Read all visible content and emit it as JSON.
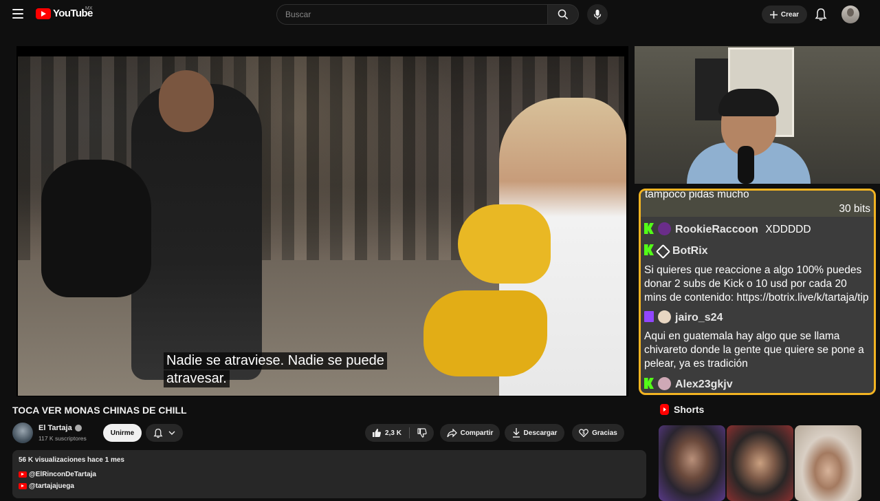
{
  "header": {
    "logo_text": "YouTube",
    "country": "MX",
    "search_placeholder": "Buscar",
    "create_label": "Crear"
  },
  "video": {
    "captions": [
      "Nadie se atraviese. Nadie se puede",
      "atravesar."
    ]
  },
  "chat": {
    "bits_message": "tampoco pidas mucho",
    "bits_count": "30 bits",
    "messages": [
      {
        "user": "RookieRaccoon",
        "text": "XDDDDD",
        "platform": "kick"
      },
      {
        "user": "BotRix",
        "text": "Si quieres que reaccione a algo 100% puedes donar 2 subs de Kick o 10 usd por cada 20 mins de contenido: https://botrix.live/k/tartaja/tip",
        "platform": "kick"
      },
      {
        "user": "jairo_s24",
        "text": "Aqui en guatemala hay algo que se llama chivareto donde la gente que quiere se pone a pelear, ya es tradición",
        "platform": "twitch"
      },
      {
        "user": "Alex23gkjv",
        "text": "",
        "platform": "kick"
      }
    ]
  },
  "meta": {
    "title": "TOCA VER MONAS CHINAS DE CHILL",
    "channel_name": "El Tartaja",
    "subscribers": "117 K suscriptores",
    "join_label": "Unirme",
    "likes": "2,3 K",
    "share_label": "Compartir",
    "download_label": "Descargar",
    "thanks_label": "Gracias"
  },
  "description": {
    "stats": "56 K visualizaciones  hace 1 mes",
    "links": [
      "@ElRinconDeTartaja",
      "@tartajajuega"
    ]
  },
  "shorts": {
    "heading": "Shorts"
  },
  "colors": {
    "background": "#0f0f0f",
    "brand_red": "#ff0000",
    "chat_border": "#f3b422",
    "kick_green": "#53fc18",
    "twitch_purple": "#9146ff"
  }
}
